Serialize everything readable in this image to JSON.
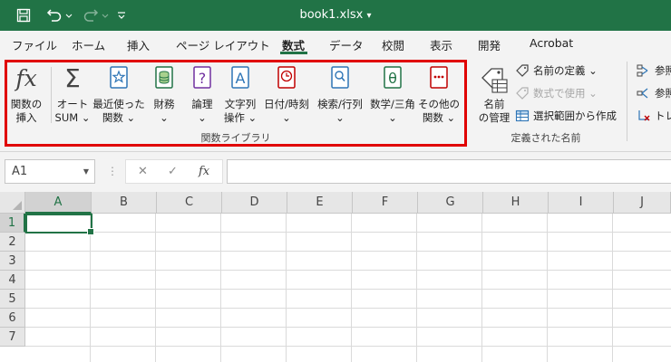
{
  "window": {
    "title": "book1.xlsx",
    "title_caret": "▾"
  },
  "tabs": [
    {
      "label": "ファイル"
    },
    {
      "label": "ホーム"
    },
    {
      "label": "挿入"
    },
    {
      "label": "ページ レイアウト"
    },
    {
      "label": "数式",
      "active": true
    },
    {
      "label": "データ"
    },
    {
      "label": "校閲"
    },
    {
      "label": "表示"
    },
    {
      "label": "開発"
    },
    {
      "label": "Acrobat"
    }
  ],
  "ribbon": {
    "function_library": {
      "group_label": "関数ライブラリ",
      "insert_function": {
        "line1": "関数の",
        "line2": "挿入",
        "icon": "fx"
      },
      "autosum": {
        "line1": "オート",
        "line2": "SUM ⌄",
        "icon": "Σ"
      },
      "recent": {
        "line1": "最近使った",
        "line2": "関数 ⌄"
      },
      "financial": {
        "line1": "財務",
        "line2": "⌄"
      },
      "logical": {
        "line1": "論理",
        "line2": "⌄",
        "icon": "?"
      },
      "text": {
        "line1": "文字列",
        "line2": "操作 ⌄",
        "icon": "A"
      },
      "datetime": {
        "line1": "日付/時刻",
        "line2": "⌄"
      },
      "lookup": {
        "line1": "検索/行列",
        "line2": "⌄"
      },
      "math": {
        "line1": "数学/三角",
        "line2": "⌄",
        "icon": "θ"
      },
      "more": {
        "line1": "その他の",
        "line2": "関数 ⌄"
      }
    },
    "defined_names": {
      "group_label": "定義された名前",
      "name_manager": {
        "line1": "名前",
        "line2": "の管理"
      },
      "define_name": "名前の定義 ⌄",
      "use_in_formula": "数式で使用 ⌄",
      "create_from_selection": "選択範囲から作成"
    },
    "auditing": {
      "trace_precedents": "参照",
      "trace_dependents": "参照",
      "remove_arrows": "トレ"
    }
  },
  "formula_bar": {
    "name_box": "A1",
    "cancel": "✕",
    "enter": "✓",
    "fx": "fx",
    "formula": ""
  },
  "grid": {
    "columns": [
      "A",
      "B",
      "C",
      "D",
      "E",
      "F",
      "G",
      "H",
      "I",
      "J"
    ],
    "rows": [
      "1",
      "2",
      "3",
      "4",
      "5",
      "6",
      "7"
    ],
    "active_cell": "A1"
  },
  "colors": {
    "accent": "#217346",
    "highlight": "#e00000"
  }
}
